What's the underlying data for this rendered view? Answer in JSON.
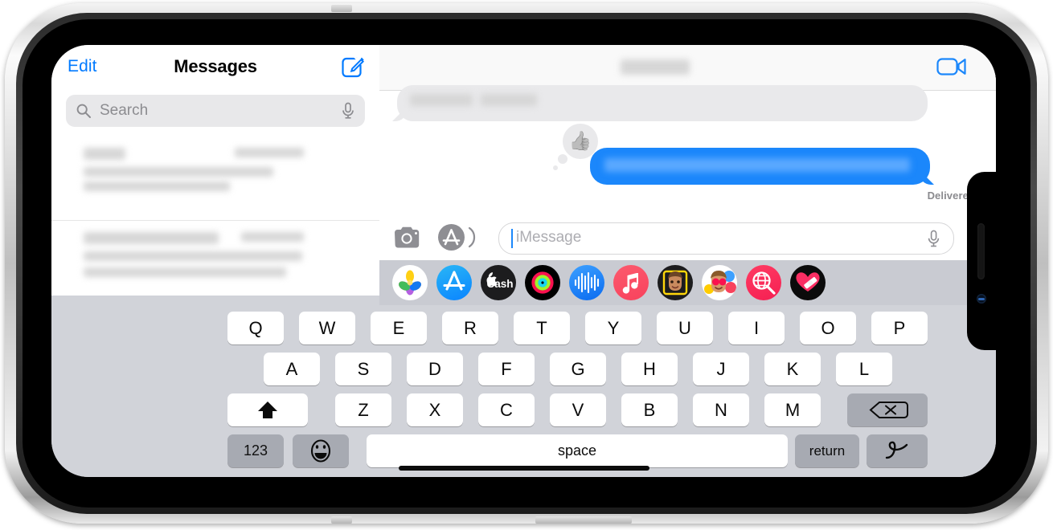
{
  "device": {
    "type": "iphone-landscape",
    "frame_color": "#cfcfcf",
    "bezel_color": "#000000"
  },
  "sidebar": {
    "edit_label": "Edit",
    "title": "Messages",
    "compose_icon": "compose-icon",
    "search": {
      "placeholder": "Search",
      "icon": "search-icon",
      "mic_icon": "microphone-icon"
    },
    "conversations": [
      {
        "name_redacted": true,
        "preview_redacted": true,
        "timestamp_redacted": true
      },
      {
        "name_redacted": true,
        "preview_redacted": true,
        "timestamp_redacted": true
      }
    ]
  },
  "conversation": {
    "contact_name_redacted": true,
    "facetime_icon": "video-camera-icon",
    "messages": [
      {
        "side": "incoming",
        "text_redacted": true,
        "bubble_color": "#e9e9eb"
      },
      {
        "side": "outgoing",
        "text_redacted": true,
        "bubble_color": "#1b87fb",
        "tapback": "👍",
        "tapback_name": "thumbs-up-tapback"
      }
    ],
    "status_label": "Delivered"
  },
  "input_bar": {
    "camera_icon": "camera-icon",
    "apps_icon": "app-store-icon",
    "placeholder": "iMessage",
    "mic_icon": "microphone-icon",
    "caret_color": "#1b87fb"
  },
  "app_drawer": {
    "apps": [
      {
        "name": "photos-app-icon",
        "label": "Photos"
      },
      {
        "name": "app-store-app-icon",
        "label": "App Store"
      },
      {
        "name": "apple-cash-app-icon",
        "label": "Apple Cash"
      },
      {
        "name": "fitness-activity-app-icon",
        "label": "Activity"
      },
      {
        "name": "voice-memos-app-icon",
        "label": "Audio"
      },
      {
        "name": "apple-music-app-icon",
        "label": "Music"
      },
      {
        "name": "memoji-app-icon",
        "label": "Memoji"
      },
      {
        "name": "memoji-stickers-app-icon",
        "label": "Memoji Stickers"
      },
      {
        "name": "images-gif-app-icon",
        "label": "#images"
      },
      {
        "name": "digital-touch-app-icon",
        "label": "Digital Touch"
      }
    ]
  },
  "keyboard": {
    "row1": [
      "Q",
      "W",
      "E",
      "R",
      "T",
      "Y",
      "U",
      "I",
      "O",
      "P"
    ],
    "row2": [
      "A",
      "S",
      "D",
      "F",
      "G",
      "H",
      "J",
      "K",
      "L"
    ],
    "row3": [
      "Z",
      "X",
      "C",
      "V",
      "B",
      "N",
      "M"
    ],
    "shift_icon": "shift-arrow-icon",
    "delete_icon": "delete-backspace-icon",
    "numbers_label": "123",
    "emoji_icon": "emoji-smiley-icon",
    "space_label": "space",
    "return_label": "return",
    "scribble_icon": "scribble-handwriting-icon",
    "globe_icon": "globe-language-icon",
    "dictation_icon": "dictation-microphone-icon",
    "key_bg": "#ffffff",
    "modifier_bg": "#a7aab2",
    "keyboard_bg": "#d1d3d9"
  },
  "home_indicator": {
    "name": "home-indicator"
  }
}
